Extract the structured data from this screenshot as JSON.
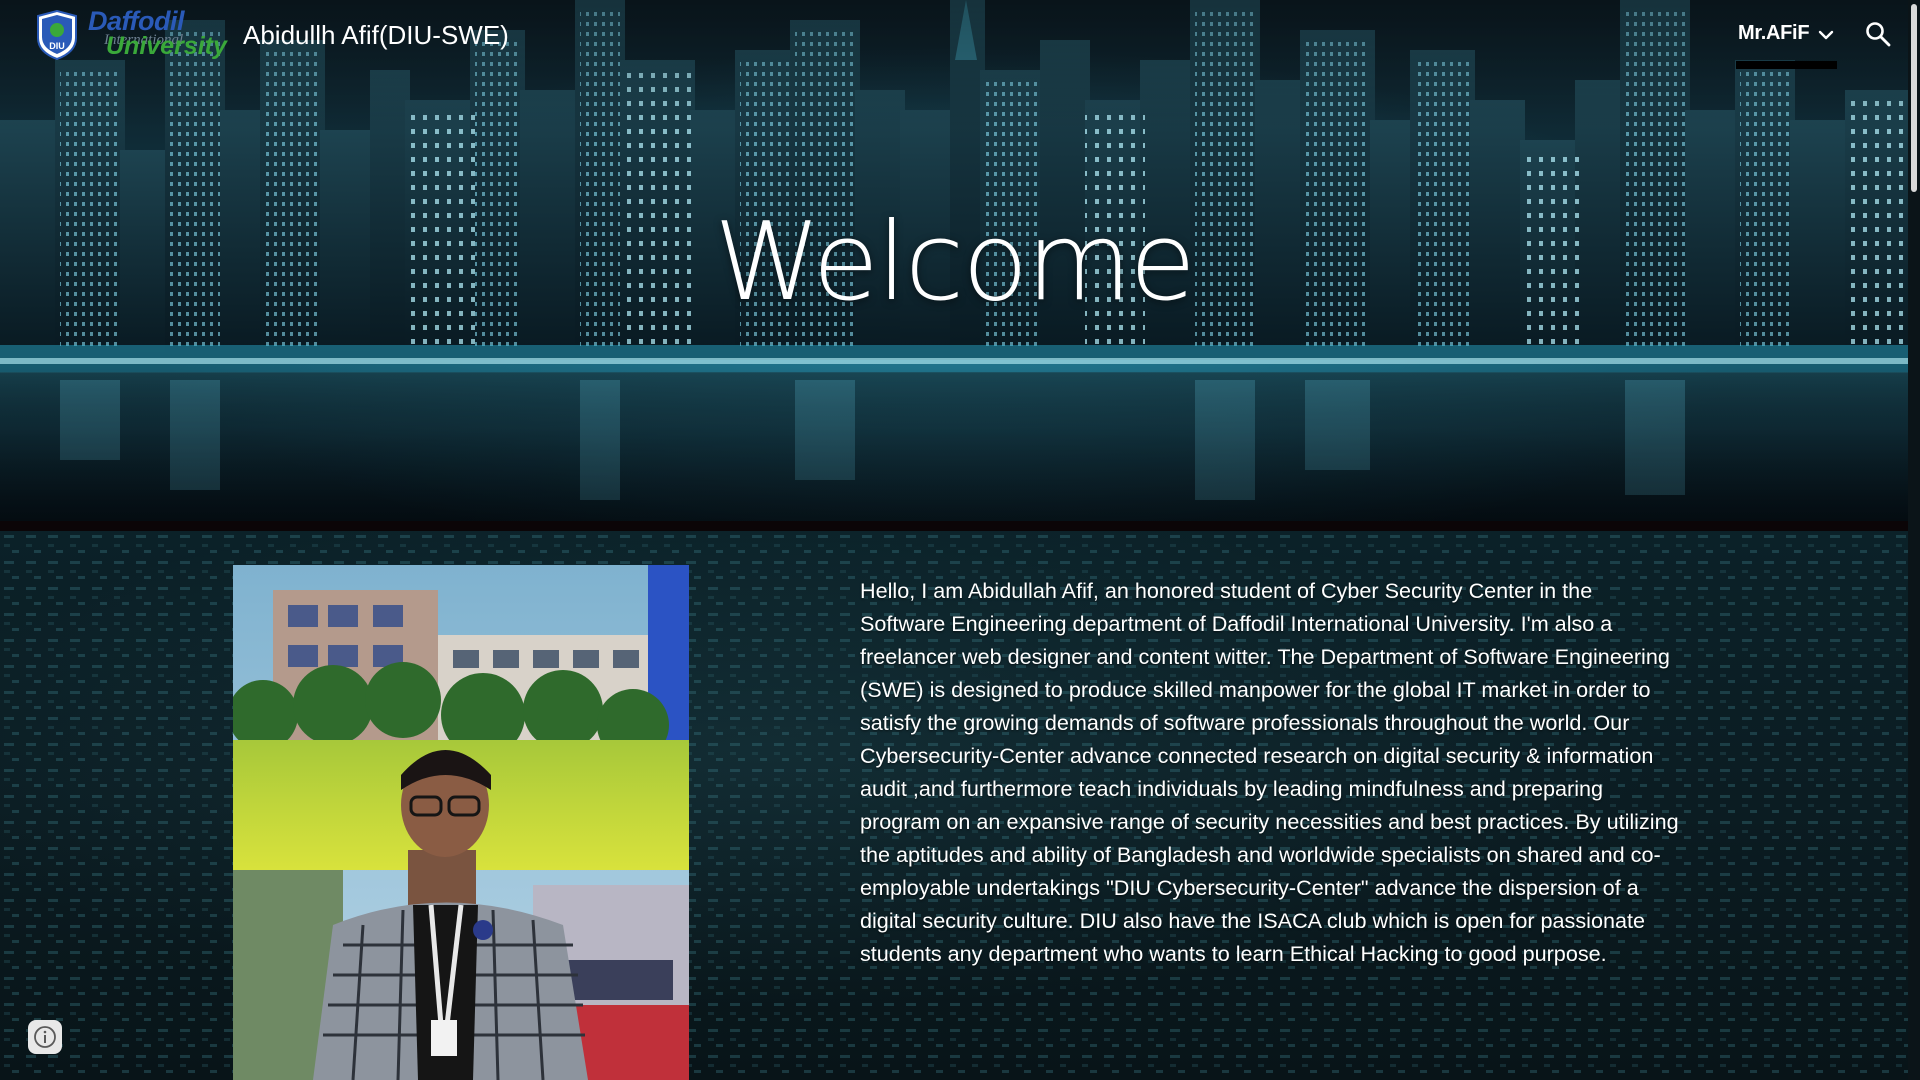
{
  "header": {
    "logo": {
      "word1": "Daffodil",
      "word2": "International",
      "word3": "University",
      "shield_text": "DIU",
      "icon": "university-shield-logo"
    },
    "site_title": "Abidullh Afif(DIU-SWE)",
    "nav": {
      "label": "Mr.AFiF",
      "icon": "chevron-down-icon"
    },
    "search_icon": "search-icon"
  },
  "hero": {
    "heading": "Welcome",
    "background": "night-city-skyline"
  },
  "main": {
    "photo_alt": "Student photo in front of campus",
    "bio": "Hello, I am Abidullah Afif, an honored student of Cyber Security Center in the Software Engineering department of Daffodil International University. I'm also a freelancer web designer and content witter. The Department of Software Engineering (SWE) is designed to produce skilled manpower for the global IT market in order to satisfy the growing demands of software professionals throughout the world. Our Cybersecurity-Center advance connected research on digital security & information audit ,and furthermore teach individuals by leading mindfulness and preparing program on an expansive range of security necessities and best practices. By utilizing the aptitudes and ability of Bangladesh and worldwide specialists on shared and co-employable undertakings \"DIU Cybersecurity-Center\" advance the dispersion of a digital security culture. DIU also have the ISACA club which is open for passionate students any department who wants to learn Ethical Hacking to good purpose."
  },
  "footer": {
    "info_icon": "info-icon"
  },
  "colors": {
    "header_text": "#ffffff",
    "logo_blue": "#2a5ab8",
    "logo_green": "#3aa83a",
    "city_glow": "#5fd4ee"
  }
}
